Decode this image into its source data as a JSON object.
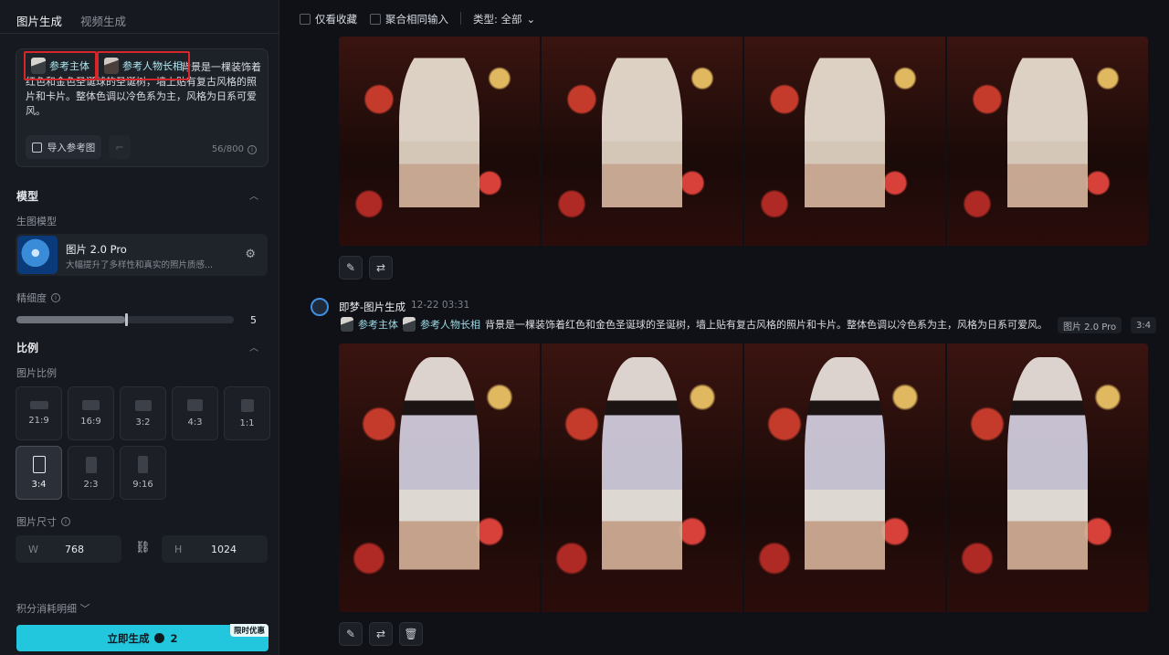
{
  "left": {
    "tabs": [
      {
        "label": "图片生成"
      },
      {
        "label": "视频生成"
      }
    ],
    "prompt": {
      "chips": [
        {
          "label": "参考主体"
        },
        {
          "label": "参考人物长相"
        }
      ],
      "text": "背景是一棵装饰着红色和金色圣诞球的圣诞树，墙上贴有复古风格的照片和卡片。整体色调以冷色系为主，风格为日系可爱风。",
      "import_label": "导入参考图",
      "counter": "56/800"
    },
    "model": {
      "section_title": "模型",
      "label": "生图模型",
      "name": "图片 2.0 Pro",
      "desc": "大幅提升了多样性和真实的照片质感..."
    },
    "detail": {
      "label": "精细度",
      "value": "5",
      "level_fraction": 0.5
    },
    "ratio": {
      "section_title": "比例",
      "label": "图片比例",
      "options": [
        "21:9",
        "16:9",
        "3:2",
        "4:3",
        "1:1",
        "3:4",
        "2:3",
        "9:16"
      ],
      "selected": "3:4"
    },
    "size": {
      "label": "图片尺寸",
      "w_prefix": "W",
      "w": "768",
      "h_prefix": "H",
      "h": "1024"
    },
    "cost_label": "积分消耗明细",
    "generate": {
      "label": "立即生成",
      "cost": "2",
      "promo": "限时优惠"
    },
    "colors": {
      "accent": "#22c7de",
      "highlight": "#d7262a"
    }
  },
  "topbar": {
    "only_fav": "仅看收藏",
    "merge": "聚合相同输入",
    "type_label": "类型: 全部"
  },
  "generation": {
    "title": "即梦-图片生成",
    "date": "12-22",
    "time": "03:31",
    "refs": [
      "参考主体",
      "参考人物长相"
    ],
    "prompt": "背景是一棵装饰着红色和金色圣诞球的圣诞树，墙上贴有复古风格的照片和卡片。整体色调以冷色系为主，风格为日系可爱风。",
    "model_tag": "图片 2.0 Pro",
    "ratio_tag": "3:4"
  },
  "icons": [
    "edit-icon",
    "regenerate-icon",
    "delete-icon",
    "link-icon",
    "settings-icon",
    "info-icon",
    "chevron-down-icon",
    "chevron-up-icon"
  ]
}
